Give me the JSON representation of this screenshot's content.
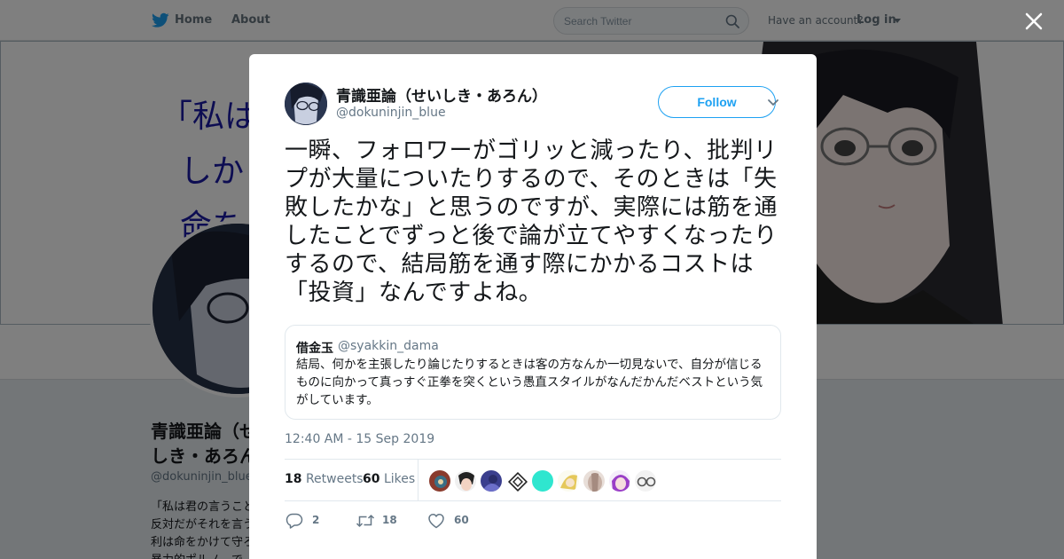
{
  "topbar": {
    "home_label": "Home",
    "about_label": "About",
    "search_placeholder": "Search Twitter",
    "account_question": "Have an account?",
    "login_label": "Log in"
  },
  "banner": {
    "lines": [
      "「私は",
      "しか",
      "命を"
    ]
  },
  "profile": {
    "name": "青識亜論（せいしき・あろん）",
    "handle": "@dokuninjin_blue",
    "bio": "「私は君の言うことに反対だがそれを言う権利は命をかけて守ろう」暴力的ポルノ…で、あらゆる表現…"
  },
  "tweet": {
    "author_name": "青識亜論（せいしき・あろん）",
    "author_handle": "@dokuninjin_blue",
    "follow_label": "Follow",
    "text": "一瞬、フォロワーがゴリッと減ったり、批判リプが大量についたりするので、そのときは「失敗したかな」と思うのですが、実際には筋を通したことでずっと後で論が立てやすくなったりするので、結局筋を通す際にかかるコストは「投資」なんですよね。",
    "quote": {
      "name": "借金玉",
      "handle": "@syakkin_dama",
      "text": "結局、何かを主張したり論じたりするときは客の方なんか一切見ないで、自分が信じるものに向かって真っすぐ正拳を突くという愚直スタイルがなんだかんだベストという気がしています。"
    },
    "timestamp": "12:40 AM - 15 Sep 2019",
    "retweets_count": "18",
    "retweets_label": "Retweets",
    "likes_count": "60",
    "likes_label": "Likes",
    "actions": {
      "reply_count": "2",
      "retweet_count": "18",
      "like_count": "60"
    }
  },
  "colors": {
    "accent": "#1da1f2",
    "muted_text": "#657786",
    "border": "#e1e8ed"
  },
  "icons": [
    "twitter-bird-icon",
    "search-icon",
    "close-icon",
    "chevron-down-icon",
    "reply-icon",
    "retweet-icon",
    "heart-icon"
  ]
}
